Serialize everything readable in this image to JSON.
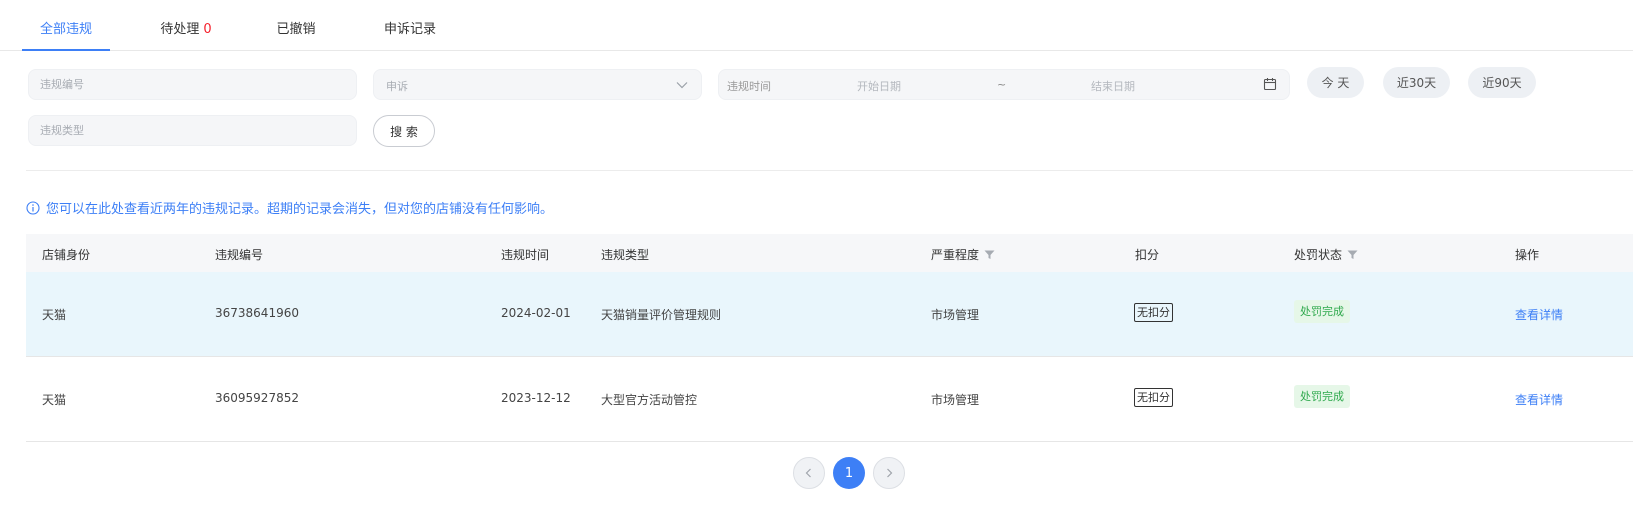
{
  "tabs": [
    {
      "label": "全部违规"
    },
    {
      "label": "待处理",
      "count": "0"
    },
    {
      "label": "已撤销"
    },
    {
      "label": "申诉记录"
    }
  ],
  "filters": {
    "violation_no_placeholder": "违规编号",
    "appeal_select": "申诉",
    "time_label": "违规时间",
    "start_placeholder": "开始日期",
    "range_sep": "~",
    "end_placeholder": "结束日期",
    "type_placeholder": "违规类型",
    "quick": [
      "今 天",
      "近30天",
      "近90天"
    ],
    "search_label": "搜 索"
  },
  "notice": "您可以在此处查看近两年的违规记录。超期的记录会消失，但对您的店铺没有任何影响。",
  "table": {
    "headers": [
      "店铺身份",
      "违规编号",
      "违规时间",
      "违规类型",
      "严重程度",
      "扣分",
      "处罚状态",
      "操作"
    ],
    "rows": [
      {
        "identity": "天猫",
        "no": "36738641960",
        "time": "2024-02-01",
        "type": "天猫销量评价管理规则",
        "severity": "市场管理",
        "points": "无扣分",
        "status": "处罚完成",
        "action": "查看详情"
      },
      {
        "identity": "天猫",
        "no": "36095927852",
        "time": "2023-12-12",
        "type": "大型官方活动管控",
        "severity": "市场管理",
        "points": "无扣分",
        "status": "处罚完成",
        "action": "查看详情"
      }
    ]
  },
  "pagination": {
    "current": "1"
  },
  "colors": {
    "accent": "#3d7ff6",
    "danger": "#f5222d",
    "success": "#2fa94d",
    "row_highlight": "#e9f6fc"
  }
}
